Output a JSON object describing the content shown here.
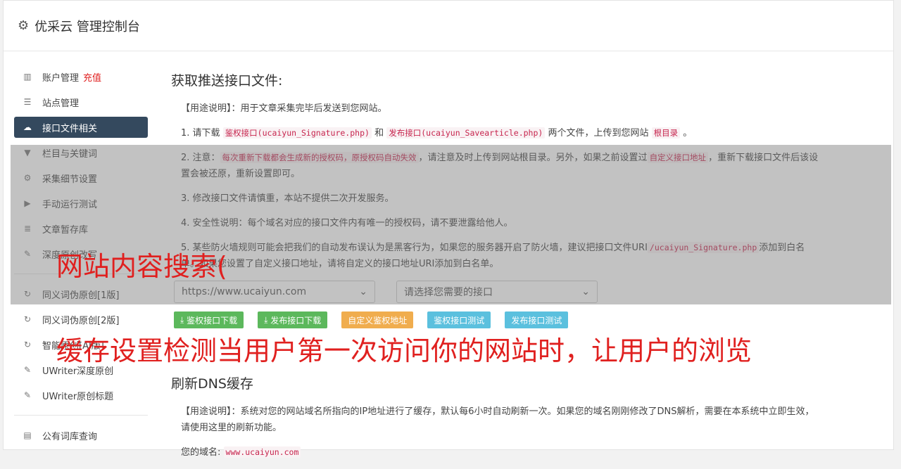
{
  "header": {
    "title": "优采云 管理控制台",
    "icon": "gear-icon"
  },
  "sidebar": {
    "group1": [
      {
        "label": "账户管理",
        "extra": "充值",
        "icon": "bar-chart-icon",
        "active": false
      },
      {
        "label": "站点管理",
        "icon": "server-icon",
        "active": false
      },
      {
        "label": "接口文件相关",
        "icon": "cloud-download-icon",
        "active": true
      },
      {
        "label": "栏目与关键词",
        "icon": "filter-icon",
        "active": false
      },
      {
        "label": "采集细节设置",
        "icon": "cogs-icon",
        "active": false
      },
      {
        "label": "手动运行测试",
        "icon": "play-circle-icon",
        "active": false
      },
      {
        "label": "文章暂存库",
        "icon": "database-icon",
        "active": false
      },
      {
        "label": "深度原创改写",
        "icon": "edit-icon",
        "active": false
      }
    ],
    "group2": [
      {
        "label": "同义词伪原创[1版]",
        "icon": "refresh-icon"
      },
      {
        "label": "同义词伪原创[2版]",
        "icon": "refresh-icon"
      },
      {
        "label": "智能原创[AI版]",
        "icon": "refresh-icon"
      },
      {
        "label": "UWriter深度原创",
        "icon": "edit-icon"
      },
      {
        "label": "UWriter原创标题",
        "icon": "edit-icon"
      }
    ],
    "group3": [
      {
        "label": "公有词库查询",
        "icon": "book-icon"
      }
    ]
  },
  "main": {
    "section1_title": "获取推送接口文件:",
    "usage_label": "【用途说明】",
    "usage_text": "：用于文章采集完毕后发送到您网站。",
    "step1": {
      "a": "1. 请下载",
      "code1": "鉴权接口(ucaiyun_Signature.php)",
      "b": "和",
      "code2": "发布接口(ucaiyun_Savearticle.php)",
      "c": "两个文件，上传到您网站",
      "code3": "根目录",
      "d": "。"
    },
    "step2": {
      "a": "2. 注意：",
      "code1": "每次重新下载都会生成新的授权码，原授权码自动失效",
      "b": "，请注意及时上传到网站根目录。另外，如果之前设置过",
      "code2": "自定义接口地址",
      "c": "，重新下载接口文件后该设置会被还原，重新设置即可。"
    },
    "step3": "3. 修改接口文件请慎重，本站不提供二次开发服务。",
    "step4": "4. 安全性说明：每个域名对应的接口文件内有唯一的授权码，请不要泄露给他人。",
    "step5": {
      "a": "5. 某些防火墙规则可能会把我们的自动发布误认为是黑客行为，如果您的服务器开启了防火墙，建议把接口文件URI",
      "code1": "/ucaiyun_Signature.php",
      "b": "添加到白名单。如果您设置了自定义接口地址，请将自定义的接口地址URI添加到白名单。"
    },
    "site_select": "https://www.ucaiyun.com",
    "api_select": "请选择您需要的接口",
    "buttons": {
      "sig": "鉴权接口下载",
      "pub": "发布接口下载",
      "custom": "自定义鉴权地址",
      "test_sig": "鉴权接口测试",
      "test_pub": "发布接口测试"
    },
    "section2_title": "刷新DNS缓存",
    "dns_usage_label": "【用途说明】",
    "dns_usage_text": "：系统对您的网站域名所指向的IP地址进行了缓存，默认每6小时自动刷新一次。如果您的域名刚刚修改了DNS解析，需要在本系统中立即生效，请使用这里的刷新功能。",
    "domain_label": "您的域名:",
    "domain_value": "www.ucaiyun.com"
  },
  "overlay": {
    "line1": "网站内容搜索(",
    "line2": "缓存设置检测当用户第一次访问你的网站时，让用户的浏览"
  }
}
